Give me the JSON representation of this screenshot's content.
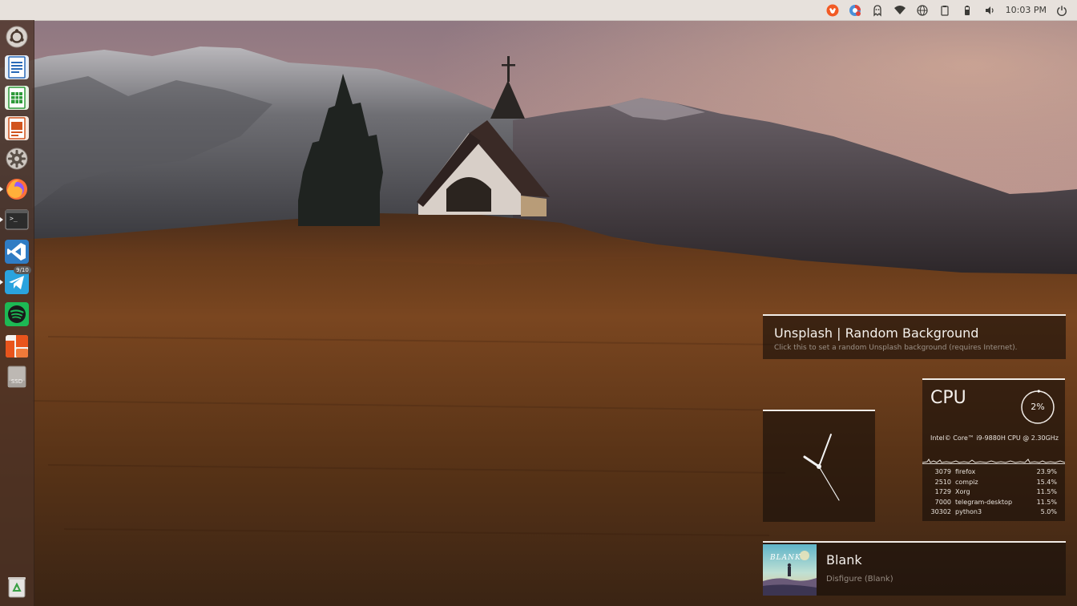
{
  "top_panel": {
    "tray_icons": [
      "brave-icon",
      "chrome-icon",
      "ghost-icon",
      "wifi-icon",
      "globe-icon",
      "clipboard-icon",
      "battery-icon",
      "volume-icon"
    ],
    "clock": "10:03 PM",
    "power_icon": "power-icon"
  },
  "launcher": {
    "items": [
      {
        "name": "launcher-home",
        "icon": "ubuntu-logo-icon"
      },
      {
        "name": "launcher-writer",
        "icon": "libreoffice-writer-icon"
      },
      {
        "name": "launcher-calc",
        "icon": "libreoffice-calc-icon"
      },
      {
        "name": "launcher-impress",
        "icon": "libreoffice-impress-icon"
      },
      {
        "name": "launcher-settings",
        "icon": "gear-icon"
      },
      {
        "name": "launcher-firefox",
        "icon": "firefox-icon"
      },
      {
        "name": "launcher-terminal",
        "icon": "terminal-icon"
      },
      {
        "name": "launcher-vscode",
        "icon": "vscode-icon"
      },
      {
        "name": "launcher-telegram",
        "icon": "telegram-icon",
        "badge": "9/10"
      },
      {
        "name": "launcher-spotify",
        "icon": "spotify-icon"
      },
      {
        "name": "launcher-unity-tweak",
        "icon": "orange-app-icon"
      },
      {
        "name": "launcher-ssd",
        "icon": "drive-icon",
        "label": "SSD"
      },
      {
        "name": "launcher-trash",
        "icon": "trash-icon"
      }
    ],
    "terminal_prompt": ">_"
  },
  "desklets": {
    "unsplash": {
      "title": "Unsplash | Random Background",
      "subtitle": "Click this to set a random Unsplash background (requires Internet)."
    },
    "cpu": {
      "title": "CPU",
      "percent": "2%",
      "percent_value": 0.02,
      "model": "Intel© Core™ i9-9880H CPU @ 2.30GHz",
      "processes": [
        {
          "pid": "3079",
          "name": "firefox",
          "cpu": "23.9%"
        },
        {
          "pid": "2510",
          "name": "compiz",
          "cpu": "15.4%"
        },
        {
          "pid": "1729",
          "name": "Xorg",
          "cpu": "11.5%"
        },
        {
          "pid": "7000",
          "name": "telegram-desktop",
          "cpu": "11.5%"
        },
        {
          "pid": "30302",
          "name": "python3",
          "cpu": "5.0%"
        }
      ]
    },
    "music": {
      "album_label": "BLANK",
      "title": "Blank",
      "artist": "Disfigure (Blank)"
    },
    "clock": {
      "time": "10:03"
    }
  },
  "colors": {
    "panel": "#e7e1dc",
    "launcher": "#4b3226",
    "desklet_bg": "#160e0a",
    "desklet_border": "#f1ece7"
  }
}
